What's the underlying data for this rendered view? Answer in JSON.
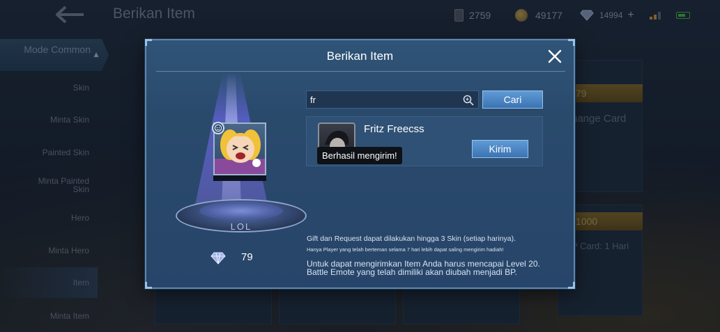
{
  "header": {
    "title": "Berikan Item",
    "resources": {
      "tickets": "2759",
      "battle_points": "49177",
      "diamonds": "14994"
    }
  },
  "sidebar": {
    "mode_label": "Mode Common",
    "items": [
      {
        "label": "Skin"
      },
      {
        "label": "Minta Skin"
      },
      {
        "label": "Painted Skin"
      },
      {
        "label": "Minta Painted Skin"
      },
      {
        "label": "Hero"
      },
      {
        "label": "Minta Hero"
      },
      {
        "label": "Item"
      },
      {
        "label": "Minta Item"
      }
    ]
  },
  "background_cards": {
    "price_1": "79",
    "card_title": "hange Card",
    "price_2": "1000",
    "card_subtitle": "P Card: 1 Hari"
  },
  "dialog": {
    "title": "Berikan Item",
    "preview": {
      "pedestal_label": "LOL",
      "price": "79"
    },
    "search": {
      "value": "fr",
      "button_label": "Cari"
    },
    "result": {
      "player_name": "Fritz Freecss",
      "send_label": "Kirim",
      "toast": "Berhasil mengirim!"
    },
    "notes": {
      "line1": "Gift dan Request dapat dilakukan hingga 3 Skin (setiap harinya).",
      "line2": "Hanya Player yang telah berteman selama 7 hari lebih dapat saling mengirim hadiah!",
      "line3": "Untuk dapat mengirimkan Item Anda harus mencapai Level 20.",
      "line4": "Battle Emote yang telah dimiliki akan diubah menjadi BP."
    }
  },
  "colors": {
    "dialog_bg": "#2a4a6c",
    "button": "#4a86c4",
    "toast_bg": "#0e1116"
  }
}
